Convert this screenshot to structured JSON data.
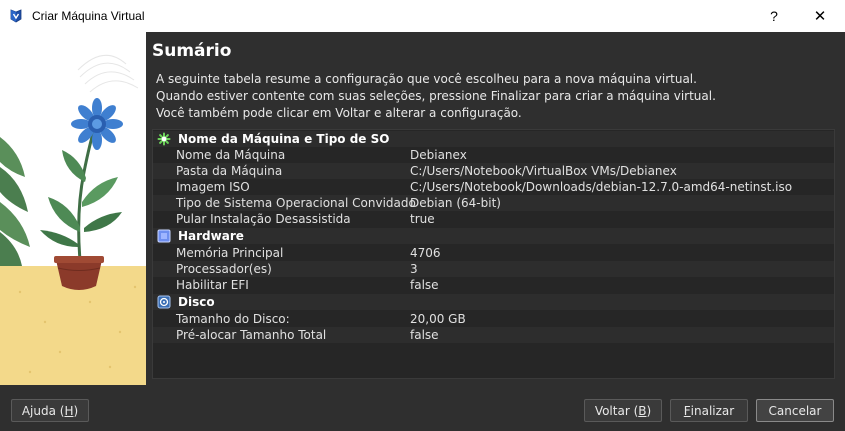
{
  "window": {
    "title": "Criar Máquina Virtual",
    "help_glyph": "?",
    "close_glyph": "✕"
  },
  "summary": {
    "heading": "Sumário",
    "description": "A seguinte tabela resume a configuração que você escolheu para a nova máquina virtual. Quando estiver contente com suas seleções, pressione Finalizar para criar a máquina virtual. Você também pode clicar em Voltar e alterar a configuração."
  },
  "sections": {
    "name_os": {
      "title": "Nome da Máquina e Tipo de SO",
      "icon": "gear-star-icon",
      "rows": [
        {
          "label": "Nome da Máquina",
          "value": "Debianex"
        },
        {
          "label": "Pasta da Máquina",
          "value": "C:/Users/Notebook/VirtualBox VMs/Debianex"
        },
        {
          "label": "Imagem ISO",
          "value": "C:/Users/Notebook/Downloads/debian-12.7.0-amd64-netinst.iso"
        },
        {
          "label": "Tipo de Sistema Operacional Convidado",
          "value": "Debian (64-bit)"
        },
        {
          "label": "Pular Instalação Desassistida",
          "value": "true"
        }
      ]
    },
    "hardware": {
      "title": "Hardware",
      "icon": "chip-icon",
      "rows": [
        {
          "label": "Memória Principal",
          "value": "4706"
        },
        {
          "label": "Processador(es)",
          "value": "3"
        },
        {
          "label": "Habilitar EFI",
          "value": "false"
        }
      ]
    },
    "disk": {
      "title": "Disco",
      "icon": "disk-icon",
      "rows": [
        {
          "label": "Tamanho do Disco:",
          "value": "20,00 GB"
        },
        {
          "label": "Pré-alocar Tamanho Total",
          "value": "false"
        }
      ]
    }
  },
  "buttons": {
    "help": {
      "text": "Ajuda (",
      "mnemonic": "H",
      "end": ")"
    },
    "back": {
      "text": "Voltar (",
      "mnemonic": "B",
      "end": ")"
    },
    "finish": {
      "mnemonic": "F",
      "text": "inalizar"
    },
    "cancel": {
      "text": "Cancelar"
    }
  },
  "colors": {
    "background": "#2f2f2f",
    "table_bg": "#262626",
    "row_alt": "#2d2d2d",
    "pot": "#8b3a2a",
    "flower_blue": "#3f7fd0",
    "floor_yellow": "#f3d98a"
  }
}
